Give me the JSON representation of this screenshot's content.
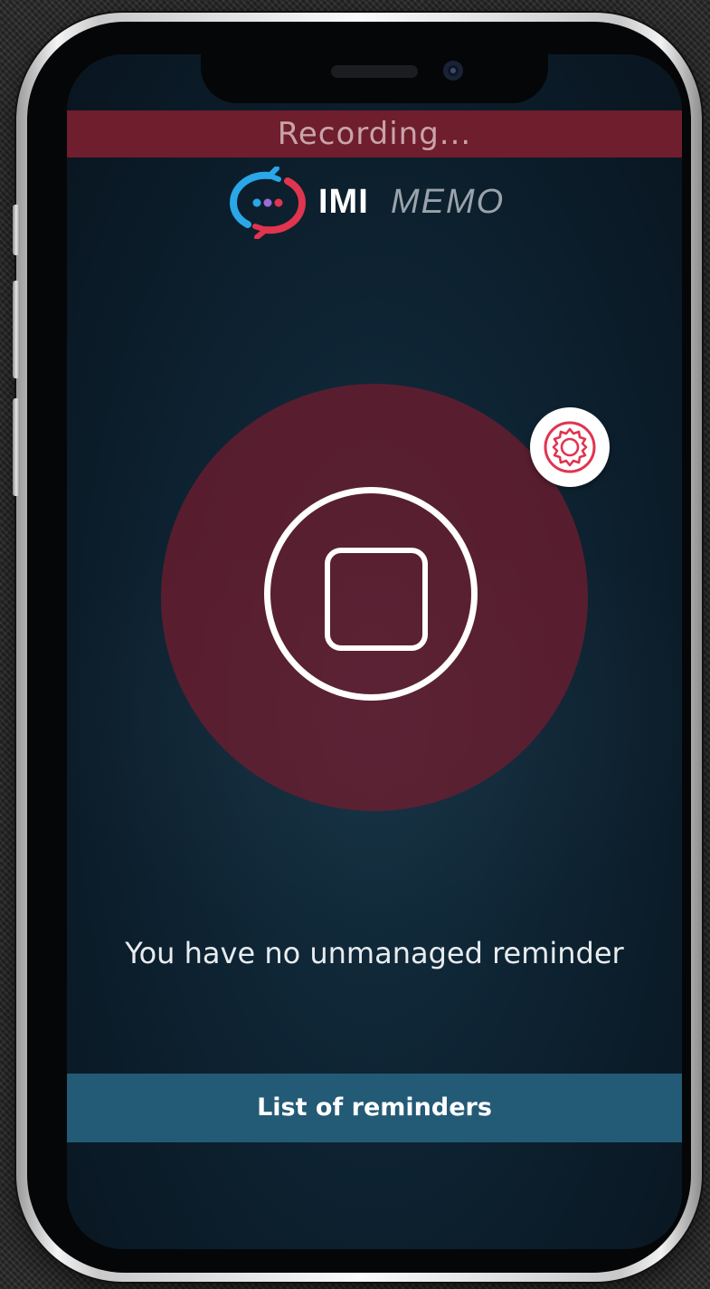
{
  "status_bar": {
    "recording_text": "Recording..."
  },
  "logo": {
    "brand_bold": "IMI",
    "brand_light": "MEMO",
    "icon": "chat-bubble-dots-icon"
  },
  "recorder": {
    "stop_icon": "stop-icon",
    "settings_icon": "gear-icon"
  },
  "main": {
    "status_message": "You have no unmanaged reminder"
  },
  "footer": {
    "list_button_label": "List of reminders"
  },
  "colors": {
    "recording_bar": "#6e1e2c",
    "record_zone": "#741c2e",
    "accent_pink": "#e0344f",
    "accent_blue": "#2aa7e8",
    "button_bg": "#235a76",
    "screen_bg": "#0f2636"
  }
}
